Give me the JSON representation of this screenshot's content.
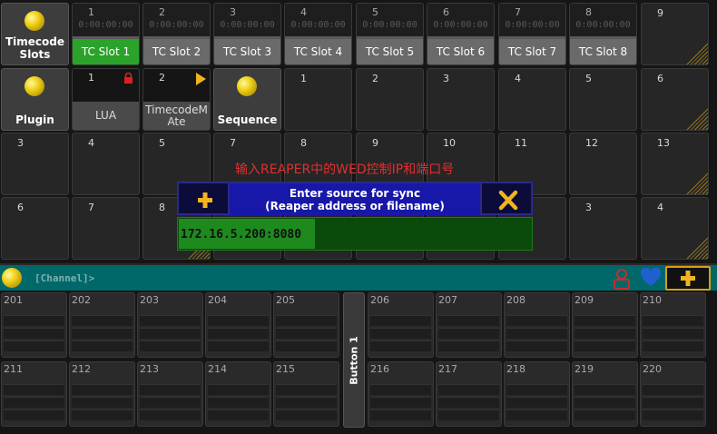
{
  "pools": {
    "timecode_slots": "Timecode\nSlots",
    "plugin": "Plugin",
    "sequence": "Sequence"
  },
  "tc_slots": [
    {
      "num": "1",
      "time": "0:00:00:00",
      "label": "TC Slot 1"
    },
    {
      "num": "2",
      "time": "0:00:00:00",
      "label": "TC Slot 2"
    },
    {
      "num": "3",
      "time": "0:00:00:00",
      "label": "TC Slot 3"
    },
    {
      "num": "4",
      "time": "0:00:00:00",
      "label": "TC Slot 4"
    },
    {
      "num": "5",
      "time": "0:00:00:00",
      "label": "TC Slot 5"
    },
    {
      "num": "6",
      "time": "0:00:00:00",
      "label": "TC Slot 6"
    },
    {
      "num": "7",
      "time": "0:00:00:00",
      "label": "TC Slot 7"
    },
    {
      "num": "8",
      "time": "0:00:00:00",
      "label": "TC Slot 8"
    }
  ],
  "tc_extra_num": "9",
  "plugins": [
    {
      "num": "1",
      "label": "LUA"
    },
    {
      "num": "2",
      "label": "TimecodeM\nAte"
    }
  ],
  "seq_nums": [
    "1",
    "2",
    "3",
    "4",
    "5",
    "6"
  ],
  "row3_nums": [
    "3",
    "4",
    "5",
    "7",
    "8",
    "9",
    "10",
    "11",
    "12",
    "13"
  ],
  "row4_nums": [
    "6",
    "7",
    "8",
    "3",
    "4"
  ],
  "overlay_text": "输入REAPER中的WED控制IP和端口号",
  "dialog": {
    "title_line1": "Enter source for sync",
    "title_line2": "(Reaper address or filename)",
    "input_value": "172.16.5.200:8080"
  },
  "command_line": {
    "prompt": "[Channel]>"
  },
  "executors_top_left": [
    "201",
    "202",
    "203",
    "204",
    "205"
  ],
  "executors_top_right": [
    "206",
    "207",
    "208",
    "209",
    "210"
  ],
  "executors_bottom_left": [
    "211",
    "212",
    "213",
    "214",
    "215"
  ],
  "executors_bottom_right": [
    "216",
    "217",
    "218",
    "219",
    "220"
  ],
  "vertical_button": "Button 1",
  "colors": {
    "active_slot": "#2ba32b",
    "dialog_blue": "#1818a8",
    "input_green": "#1e8a1e",
    "cmd_teal": "#006868",
    "accent_gold": "#d4a017"
  }
}
